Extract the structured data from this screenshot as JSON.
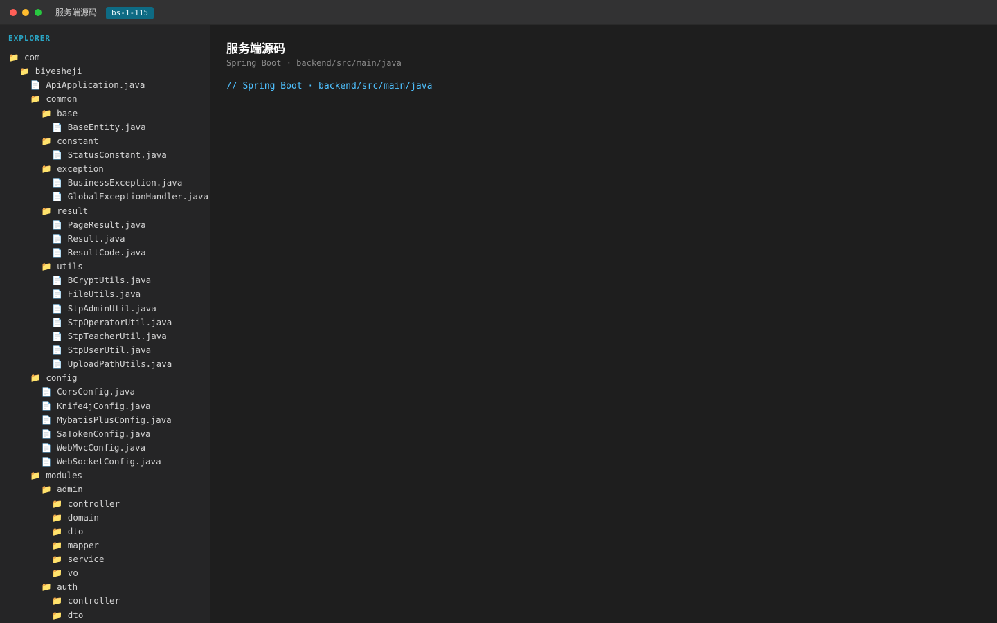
{
  "window": {
    "title": "服务端源码",
    "badge": "bs-1-115"
  },
  "sidebar": {
    "header": "EXPLORER",
    "tree": [
      {
        "label": "com",
        "type": "folder",
        "depth": 0
      },
      {
        "label": "biyesheji",
        "type": "folder",
        "depth": 1
      },
      {
        "label": "ApiApplication.java",
        "type": "file",
        "depth": 2
      },
      {
        "label": "common",
        "type": "folder",
        "depth": 2
      },
      {
        "label": "base",
        "type": "folder",
        "depth": 3
      },
      {
        "label": "BaseEntity.java",
        "type": "file",
        "depth": 4
      },
      {
        "label": "constant",
        "type": "folder",
        "depth": 3
      },
      {
        "label": "StatusConstant.java",
        "type": "file",
        "depth": 4
      },
      {
        "label": "exception",
        "type": "folder",
        "depth": 3
      },
      {
        "label": "BusinessException.java",
        "type": "file",
        "depth": 4
      },
      {
        "label": "GlobalExceptionHandler.java",
        "type": "file",
        "depth": 4
      },
      {
        "label": "result",
        "type": "folder",
        "depth": 3
      },
      {
        "label": "PageResult.java",
        "type": "file",
        "depth": 4
      },
      {
        "label": "Result.java",
        "type": "file",
        "depth": 4
      },
      {
        "label": "ResultCode.java",
        "type": "file",
        "depth": 4
      },
      {
        "label": "utils",
        "type": "folder",
        "depth": 3
      },
      {
        "label": "BCryptUtils.java",
        "type": "file",
        "depth": 4
      },
      {
        "label": "FileUtils.java",
        "type": "file",
        "depth": 4
      },
      {
        "label": "StpAdminUtil.java",
        "type": "file",
        "depth": 4
      },
      {
        "label": "StpOperatorUtil.java",
        "type": "file",
        "depth": 4
      },
      {
        "label": "StpTeacherUtil.java",
        "type": "file",
        "depth": 4
      },
      {
        "label": "StpUserUtil.java",
        "type": "file",
        "depth": 4
      },
      {
        "label": "UploadPathUtils.java",
        "type": "file",
        "depth": 4
      },
      {
        "label": "config",
        "type": "folder",
        "depth": 2
      },
      {
        "label": "CorsConfig.java",
        "type": "file",
        "depth": 3
      },
      {
        "label": "Knife4jConfig.java",
        "type": "file",
        "depth": 3
      },
      {
        "label": "MybatisPlusConfig.java",
        "type": "file",
        "depth": 3
      },
      {
        "label": "SaTokenConfig.java",
        "type": "file",
        "depth": 3
      },
      {
        "label": "WebMvcConfig.java",
        "type": "file",
        "depth": 3
      },
      {
        "label": "WebSocketConfig.java",
        "type": "file",
        "depth": 3
      },
      {
        "label": "modules",
        "type": "folder",
        "depth": 2
      },
      {
        "label": "admin",
        "type": "folder",
        "depth": 3
      },
      {
        "label": "controller",
        "type": "folder",
        "depth": 4
      },
      {
        "label": "domain",
        "type": "folder",
        "depth": 4
      },
      {
        "label": "dto",
        "type": "folder",
        "depth": 4
      },
      {
        "label": "mapper",
        "type": "folder",
        "depth": 4
      },
      {
        "label": "service",
        "type": "folder",
        "depth": 4
      },
      {
        "label": "vo",
        "type": "folder",
        "depth": 4
      },
      {
        "label": "auth",
        "type": "folder",
        "depth": 3
      },
      {
        "label": "controller",
        "type": "folder",
        "depth": 4
      },
      {
        "label": "dto",
        "type": "folder",
        "depth": 4
      }
    ]
  },
  "main": {
    "title": "服务端源码",
    "subtitle": "Spring Boot · backend/src/main/java",
    "code_line": "// Spring Boot · backend/src/main/java"
  },
  "icons": {
    "folder": "📁",
    "file": "📄"
  },
  "colors": {
    "accent": "#2aa7c6",
    "badge_bg": "#0e6b84",
    "folder": "#e2b341",
    "comment": "#4fc1ff"
  }
}
